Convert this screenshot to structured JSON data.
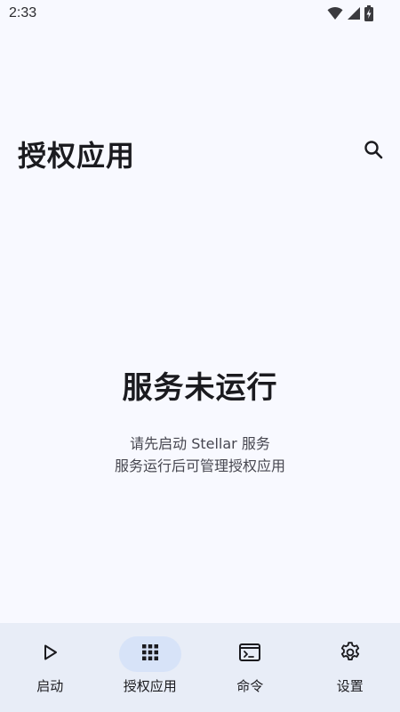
{
  "status_bar": {
    "time": "2:33",
    "icons": [
      "wifi-icon",
      "cell-signal-icon",
      "battery-charging-icon"
    ]
  },
  "header": {
    "title": "授权应用",
    "search_icon": "search-icon"
  },
  "empty_state": {
    "title": "服务未运行",
    "line1": "请先启动 Stellar 服务",
    "line2": "服务运行后可管理授权应用"
  },
  "bottom_nav": {
    "items": [
      {
        "label": "启动",
        "icon": "play-icon",
        "active": false
      },
      {
        "label": "授权应用",
        "icon": "apps-grid-icon",
        "active": true
      },
      {
        "label": "命令",
        "icon": "terminal-icon",
        "active": false
      },
      {
        "label": "设置",
        "icon": "gear-icon",
        "active": false
      }
    ]
  },
  "colors": {
    "background": "#f8f9ff",
    "nav_background": "#e8edf7",
    "nav_active_indicator": "#d7e3f8",
    "text_primary": "#1b1b1f",
    "text_secondary": "#46464f"
  }
}
